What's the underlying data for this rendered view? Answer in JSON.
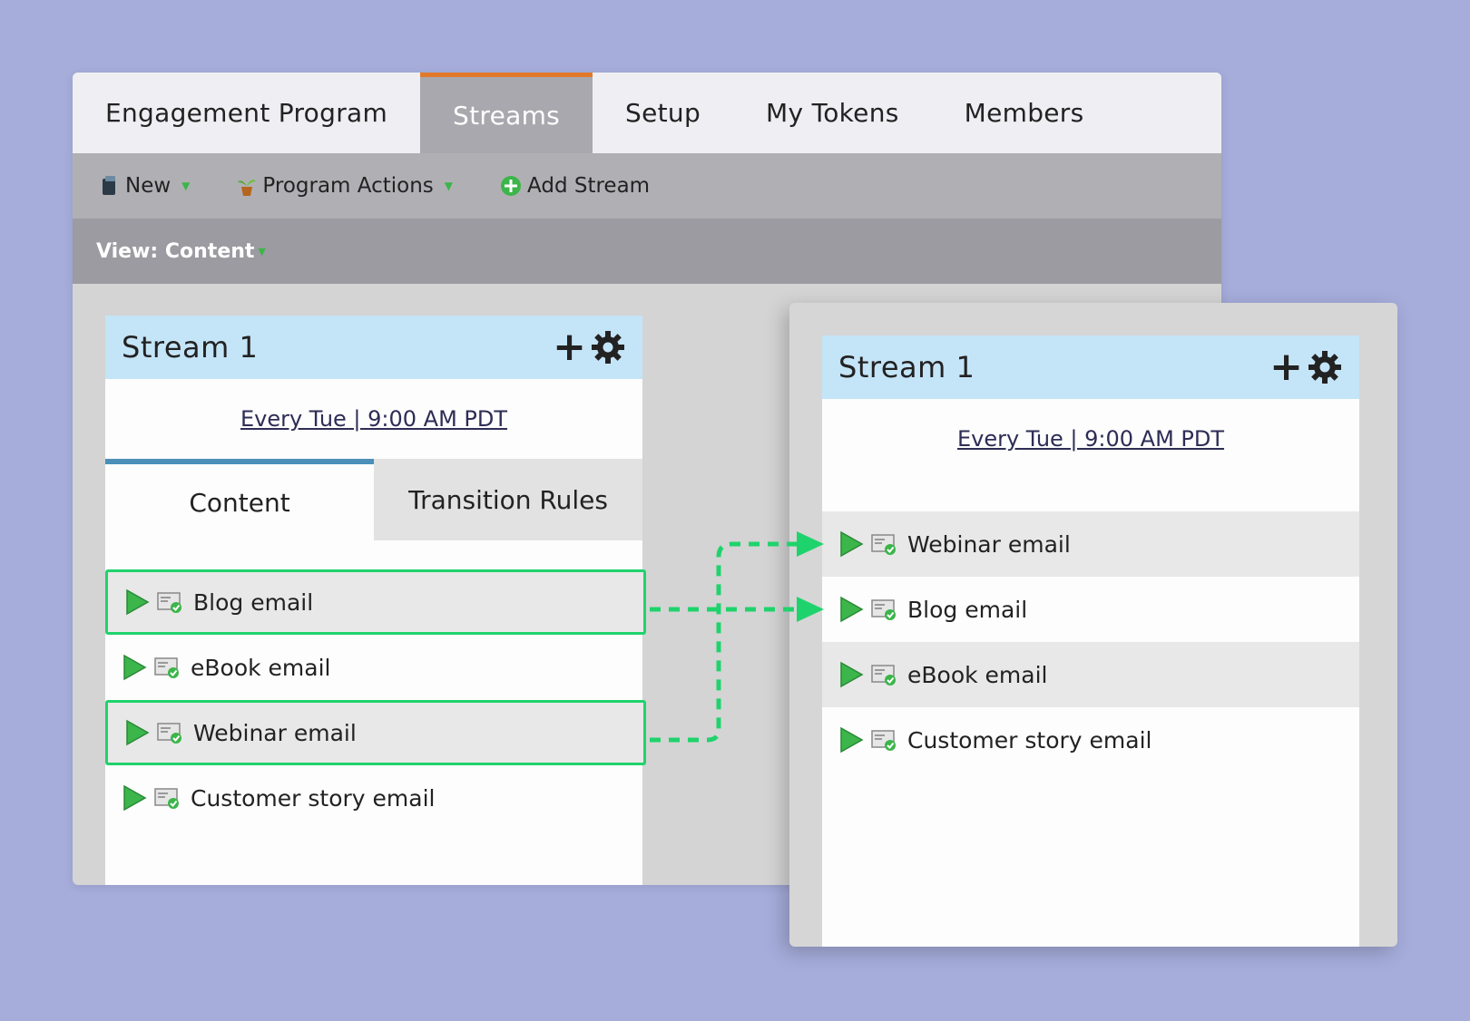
{
  "tabs": [
    {
      "label": "Engagement Program",
      "active": false
    },
    {
      "label": "Streams",
      "active": true
    },
    {
      "label": "Setup",
      "active": false
    },
    {
      "label": "My Tokens",
      "active": false
    },
    {
      "label": "Members",
      "active": false
    }
  ],
  "toolbar": {
    "new_label": "New",
    "program_actions_label": "Program Actions",
    "add_stream_label": "Add Stream"
  },
  "viewbar": {
    "label": "View: Content"
  },
  "left_stream": {
    "title": "Stream 1",
    "cadence": "Every Tue | 9:00 AM PDT",
    "subtabs": [
      "Content",
      "Transition Rules"
    ],
    "items": [
      "Blog email",
      "eBook email",
      "Webinar email",
      "Customer story email"
    ],
    "highlighted": [
      "Blog email",
      "Webinar email"
    ]
  },
  "right_stream": {
    "title": "Stream 1",
    "cadence": "Every Tue | 9:00 AM PDT",
    "items": [
      "Webinar email",
      "Blog email",
      "eBook email",
      "Customer story email"
    ]
  },
  "colors": {
    "background": "#a6addb",
    "active_tab_accent": "#e07a2a",
    "highlight_border": "#1fd36c",
    "stream_header": "#c4e4f7"
  },
  "icons": [
    "plus-icon",
    "gear-icon",
    "play-icon",
    "email-icon",
    "new-icon",
    "plant-icon",
    "add-circle-icon",
    "arrow-icon"
  ]
}
